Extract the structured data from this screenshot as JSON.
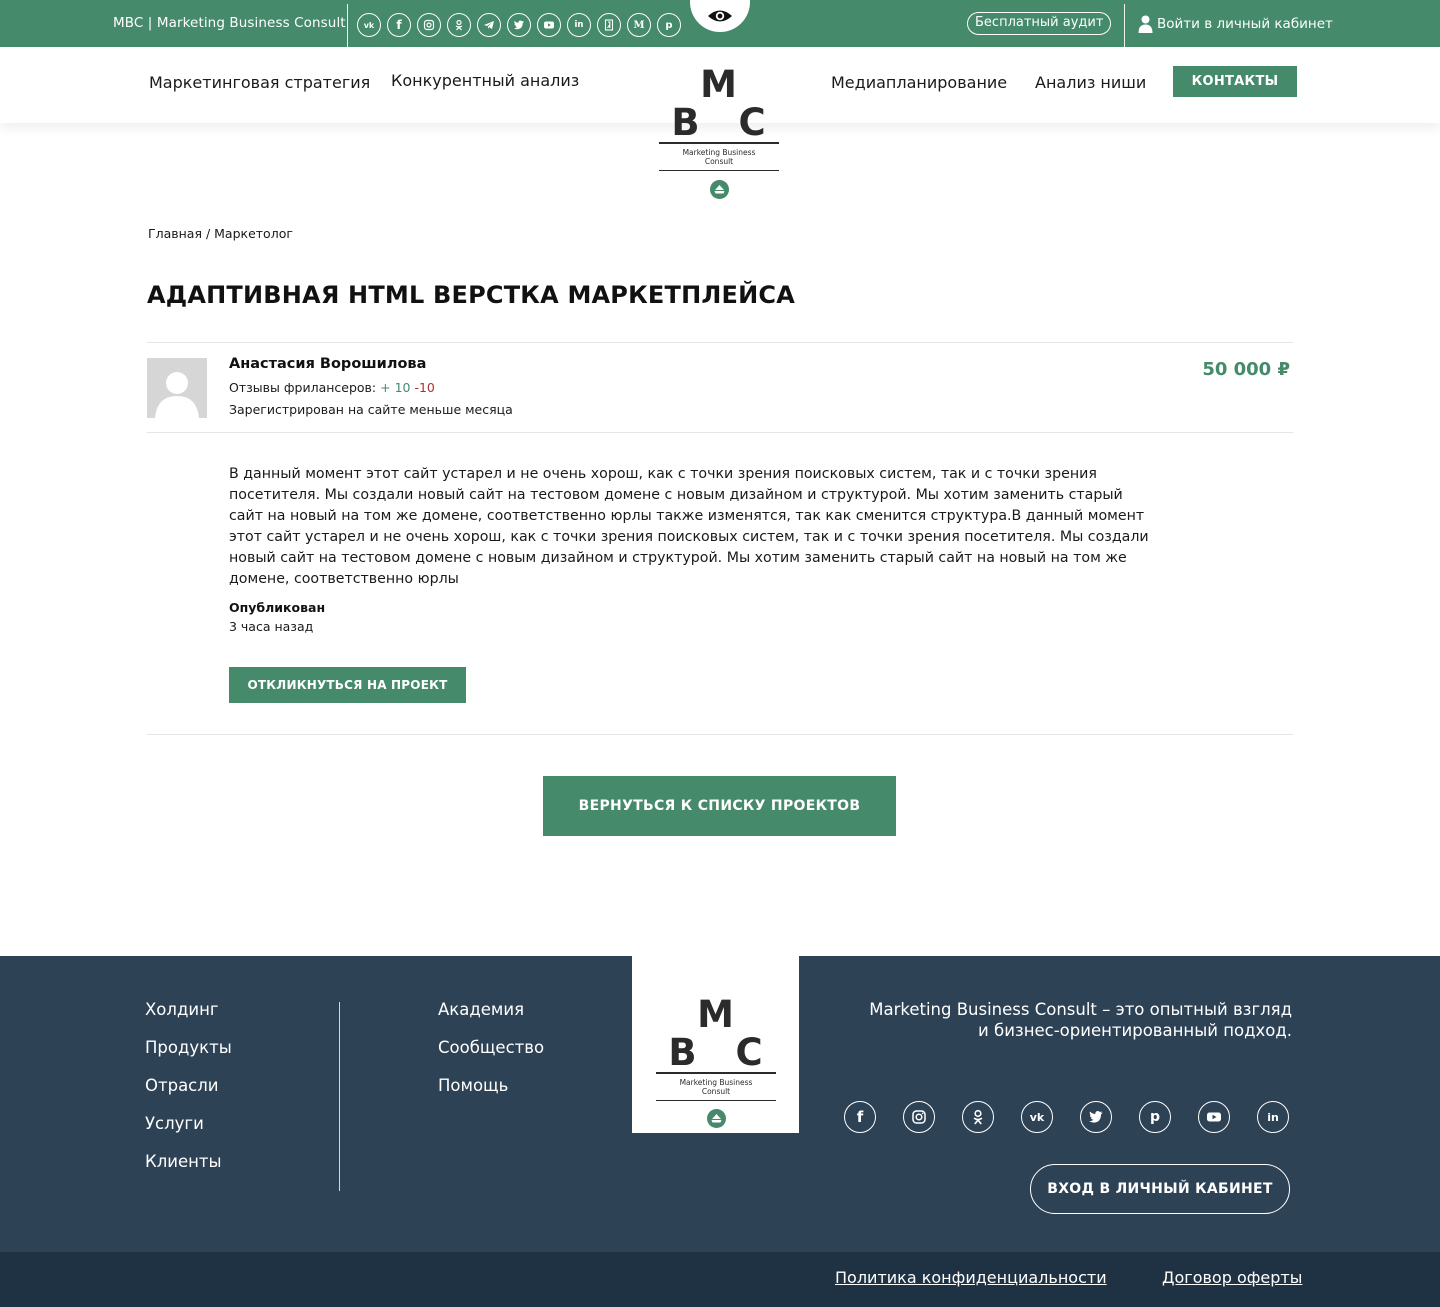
{
  "topbar": {
    "site_name": "MBC | Marketing Business Consult",
    "social": [
      "vk-icon",
      "facebook-icon",
      "instagram-icon",
      "odnoklassniki-icon",
      "telegram-icon",
      "twitter-icon",
      "youtube-icon",
      "linkedin-icon",
      "yandex-zen-icon",
      "medium-icon",
      "pinterest-icon"
    ],
    "audit_label": "Бесплатный аудит",
    "login_label": "Войти в личный кабинет"
  },
  "nav": {
    "left": [
      "Маркетинговая стратегия",
      "Конкурентный анализ"
    ],
    "right": [
      "Медиапланирование",
      "Анализ ниши"
    ],
    "contacts_label": "КОНТАКТЫ"
  },
  "logo": {
    "letters": "M B C",
    "subtitle_line1": "Marketing Business",
    "subtitle_line2": "Consult"
  },
  "breadcrumb": "Главная / Маркетолог",
  "project": {
    "title": "АДАПТИВНАЯ HTML ВЕРСТКА МАРКЕТПЛЕЙСА",
    "author": "Анастасия Ворошилова",
    "reviews_label": "Отзывы фрилансеров:",
    "reviews_positive": "+ 10",
    "reviews_negative": "-10",
    "registered": "Зарегистрирован на сайте меньше месяца",
    "price": "50 000 ₽",
    "description": "В данный момент этот сайт устарел и не очень хорош, как с точки зрения поисковых систем, так и с точки зрения посетителя. Мы создали новый сайт на тестовом домене с новым дизайном и структурой. Мы хотим заменить старый сайт на новый на том же домене, соответственно юрлы также изменятся, так как сменится структура.В данный момент этот сайт устарел и не очень хорош, как с точки зрения поисковых систем, так и с точки зрения посетителя. Мы создали новый сайт на тестовом домене с новым дизайном и структурой. Мы хотим заменить старый сайт на новый на том же домене, соответственно юрлы",
    "published_label": "Опубликован",
    "published_value": "3 часа назад",
    "respond_label": "ОТКЛИКНУТЬСЯ НА ПРОЕКТ"
  },
  "back_label": "ВЕРНУТЬСЯ К СПИСКУ ПРОЕКТОВ",
  "footer": {
    "col1": [
      "Холдинг",
      "Продукты",
      "Отрасли",
      "Услуги",
      "Клиенты"
    ],
    "col2": [
      "Академия",
      "Сообщество",
      "Помощь"
    ],
    "tagline_line1": "Marketing Business Consult – это опытный взгляд",
    "tagline_line2": "и бизнес-ориентированный подход.",
    "social": [
      "facebook-icon",
      "instagram-icon",
      "odnoklassniki-icon",
      "vk-icon",
      "twitter-icon",
      "pinterest-icon",
      "youtube-icon",
      "linkedin-icon"
    ],
    "login_label": "ВХОД В ЛИЧНЫЙ КАБИНЕТ",
    "privacy_label": "Политика конфиденциальности",
    "offer_label": "Договор оферты"
  },
  "colors": {
    "brand_green": "#448a6b",
    "footer_bg": "#2e4256",
    "subfooter_bg": "#1f3244"
  }
}
